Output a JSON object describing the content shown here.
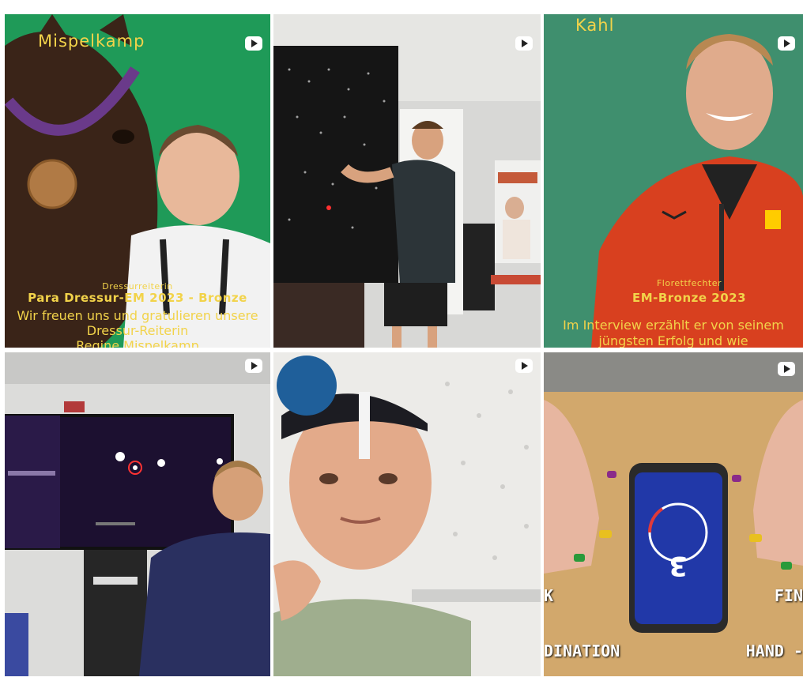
{
  "tiles": [
    {
      "name_top": "Mispelkamp",
      "subtitle": "Dressurreiterin",
      "headline": "Para Dressur-EM 2023 - Bronze",
      "desc_1": "Wir freuen uns und gratulieren unsere",
      "desc_2": "Dressur-Reiterin",
      "desc_3": "Regine Mispelkamp"
    },
    {
      "name_top": ""
    },
    {
      "name_top": "Kahl",
      "subtitle": "Florettfechter",
      "headline": "EM-Bronze 2023",
      "desc_1": "Im Interview erzählt er von seinem",
      "desc_2": "jüngsten Erfolg und wie"
    },
    {
      "name_top": ""
    },
    {
      "name_top": ""
    },
    {
      "phone_number": "3",
      "label_left_top": "K",
      "label_right_top": "FIN",
      "label_left_bottom": "DINATION",
      "label_right_bottom": "HAND -"
    }
  ],
  "colors": {
    "green_bg": "#1f9a58",
    "teal_bg": "#3f8f6e",
    "yellow_text": "#f2d34a"
  }
}
